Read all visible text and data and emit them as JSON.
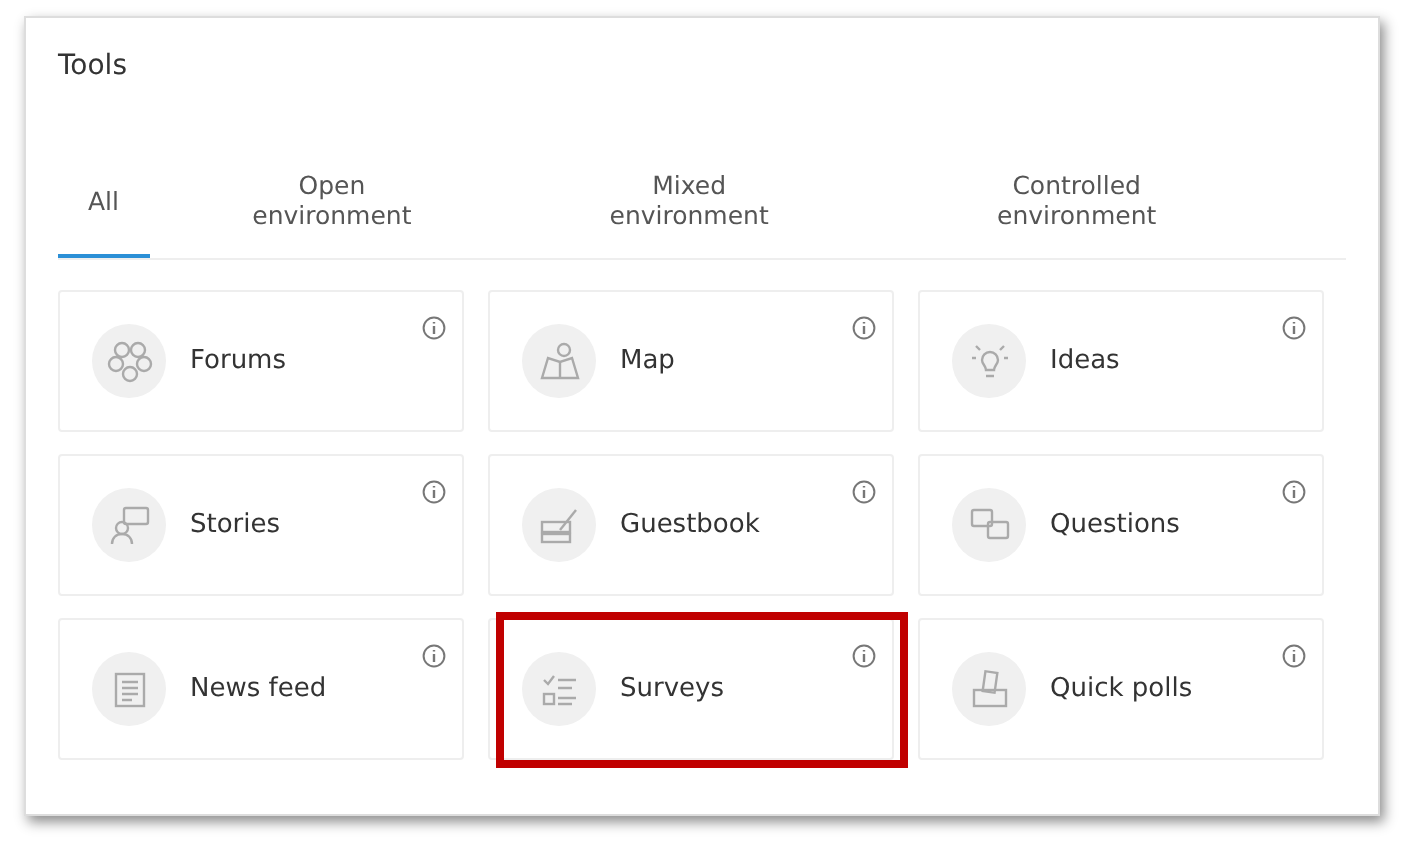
{
  "panel": {
    "title": "Tools"
  },
  "tabs": [
    {
      "label": "All",
      "selected": true
    },
    {
      "label": "Open environment",
      "selected": false
    },
    {
      "label": "Mixed environment",
      "selected": false
    },
    {
      "label": "Controlled environment",
      "selected": false
    }
  ],
  "tools": [
    {
      "label": "Forums",
      "highlighted": false
    },
    {
      "label": "Map",
      "highlighted": false
    },
    {
      "label": "Ideas",
      "highlighted": false
    },
    {
      "label": "Stories",
      "highlighted": false
    },
    {
      "label": "Guestbook",
      "highlighted": false
    },
    {
      "label": "Questions",
      "highlighted": false
    },
    {
      "label": "News feed",
      "highlighted": false
    },
    {
      "label": "Surveys",
      "highlighted": true
    },
    {
      "label": "Quick polls",
      "highlighted": false
    }
  ]
}
